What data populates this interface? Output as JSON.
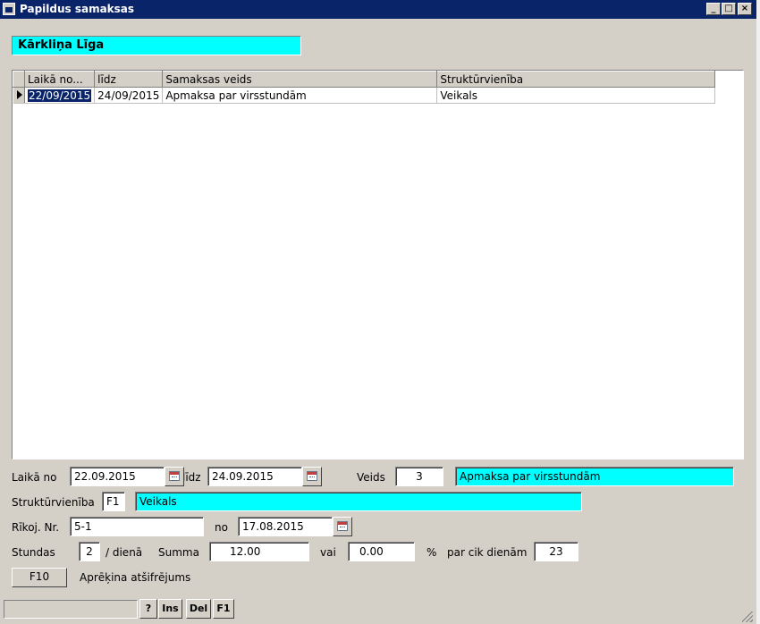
{
  "window": {
    "title": "Papildus samaksas"
  },
  "employee": {
    "name": "Kārkliņa Līga"
  },
  "grid": {
    "columns": [
      "Laikā no...",
      "līdz",
      "Samaksas veids",
      "Struktūrvienība"
    ],
    "rows": [
      [
        "22/09/2015",
        "24/09/2015",
        "Apmaksa par virsstundām",
        "Veikals"
      ]
    ]
  },
  "form": {
    "from_label": "Laikā no",
    "from_value": "22.09.2015",
    "to_label": "līdz",
    "to_value": "24.09.2015",
    "type_label": "Veids",
    "type_code": "3",
    "type_name": "Apmaksa par virsstundām",
    "unit_label": "Struktūrvienība",
    "unit_code": "F1",
    "unit_name": "Veikals",
    "order_label": "Rīkoj. Nr.",
    "order_value": "5-1",
    "order_date_label": "no",
    "order_date_value": "17.08.2015",
    "hours_label": "Stundas",
    "hours_value": "2",
    "per_day_label": "/ dienā",
    "sum_label": "Summa",
    "sum_value": "12.00",
    "or_label": "vai",
    "percent_value": "0.00",
    "percent_sign": "%",
    "days_label": "par cik dienām",
    "days_value": "23",
    "f10_label": "F10",
    "calc_label": "Aprēķina atšifrējums"
  },
  "statusbar": {
    "help": "?",
    "ins": "Ins",
    "del": "Del",
    "f1": "F1"
  },
  "colors": {
    "highlight": "#00ffff",
    "titlebar": "#0a246a",
    "selection": "#0a246a"
  }
}
